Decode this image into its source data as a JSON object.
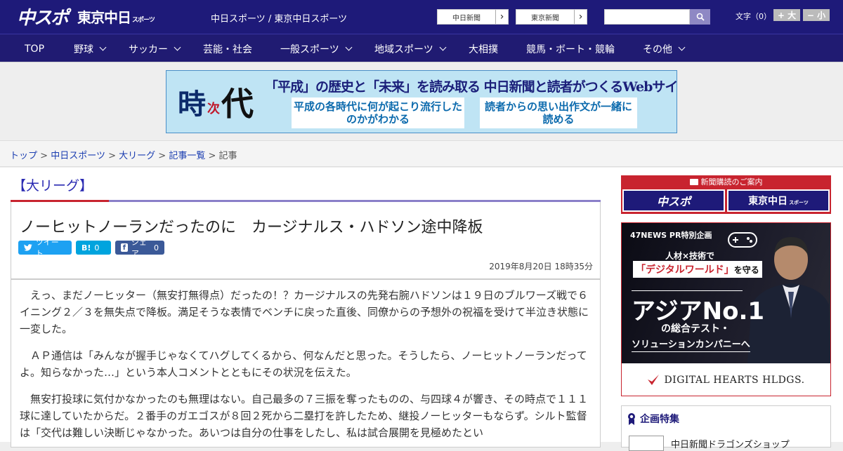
{
  "header": {
    "logo_primary": "中スポ",
    "logo_secondary": "東京中日",
    "logo_secondary_sub": "スポーツ",
    "site_link": "中日スポーツ / 東京中日スポーツ",
    "paper_links": [
      "中日新聞",
      "東京新聞"
    ],
    "search": {
      "placeholder": ""
    },
    "font_size_label": "文字（0）",
    "font_larger": "+ 大",
    "font_smaller": "− 小"
  },
  "nav": {
    "items": [
      {
        "label": "TOP",
        "has_menu": false
      },
      {
        "label": "野球",
        "has_menu": true
      },
      {
        "label": "サッカー",
        "has_menu": true
      },
      {
        "label": "芸能・社会",
        "has_menu": false
      },
      {
        "label": "一般スポーツ",
        "has_menu": true
      },
      {
        "label": "地域スポーツ",
        "has_menu": true
      },
      {
        "label": "大相撲",
        "has_menu": false
      },
      {
        "label": "競馬・ボート・競輪",
        "has_menu": false
      },
      {
        "label": "その他",
        "has_menu": true
      }
    ]
  },
  "banner": {
    "kanji_1": "時",
    "kanji_2": "次",
    "kanji_3": "代",
    "headline": "「平成」の歴史と「未来」を読み取る 中日新聞と読者がつくるWebサイト",
    "box_left": "平成の各時代に何が起こり流行したのかがわかる",
    "box_right": "読者からの思い出作文が一緒に読める"
  },
  "breadcrumb": {
    "items": [
      "トップ",
      "中日スポーツ",
      "大リーグ",
      "記事一覧"
    ],
    "current": "記事",
    "separator": ">"
  },
  "article": {
    "category": "【大リーグ】",
    "title": "ノーヒットノーランだったのに　カージナルス・ハドソン途中降板",
    "share": {
      "tweet": "ツイート",
      "hatena_icon": "B!",
      "hatena_count": "0",
      "facebook_icon": "f",
      "facebook_label": "シェア",
      "facebook_count": "0"
    },
    "date": "2019年8月20日 18時35分",
    "paragraphs": [
      "えっ、まだノーヒッター（無安打無得点）だったの！？カージナルスの先発右腕ハドソンは１９日のブルワーズ戦で６イニング２／３を無失点で降板。満足そうな表情でベンチに戻った直後、同僚からの予想外の祝福を受けて半泣き状態に一変した。",
      "ＡＰ通信は「みんなが握手じゃなくてハグしてくるから、何なんだと思った。そうしたら、ノーヒットノーランだってよ。知らなかった…」という本人コメントとともにその状況を伝えた。",
      "無安打投球に気付かなかったのも無理はない。自己最多の７三振を奪ったものの、与四球４が響き、その時点で１１１球に達していたからだ。２番手のガエゴスが８回２死から二塁打を許したため、継投ノーヒッターもならず。シルト監督は「交代は難しい決断じゃなかった。あいつは自分の仕事をしたし、私は試合展開を見極めたとい"
    ]
  },
  "sidebar": {
    "promo_title": "新聞購読のご案内",
    "promo_buttons": [
      "中スポ",
      "東京中日"
    ],
    "promo_button_sub": "スポーツ",
    "ad": {
      "tag": "47NEWS PR特別企画",
      "line1": "人材×技術で",
      "line2": "「デジタルワールド」",
      "line2_suffix": "を守る",
      "line3": "アジアNo.1",
      "line4": "の総合テスト・",
      "line5": "ソリューションカンパニーへ",
      "brand": "DIGITAL HEARTS HLDGS."
    },
    "feature": {
      "title": "企画特集",
      "item": "中日新聞ドラゴンズショップ"
    }
  },
  "colors": {
    "header_bg": "#1e1a79",
    "accent_red": "#c8242f",
    "link_blue": "#1a3db0",
    "twitter": "#1da1f2",
    "hatena": "#00a4de",
    "facebook": "#3b5998"
  }
}
